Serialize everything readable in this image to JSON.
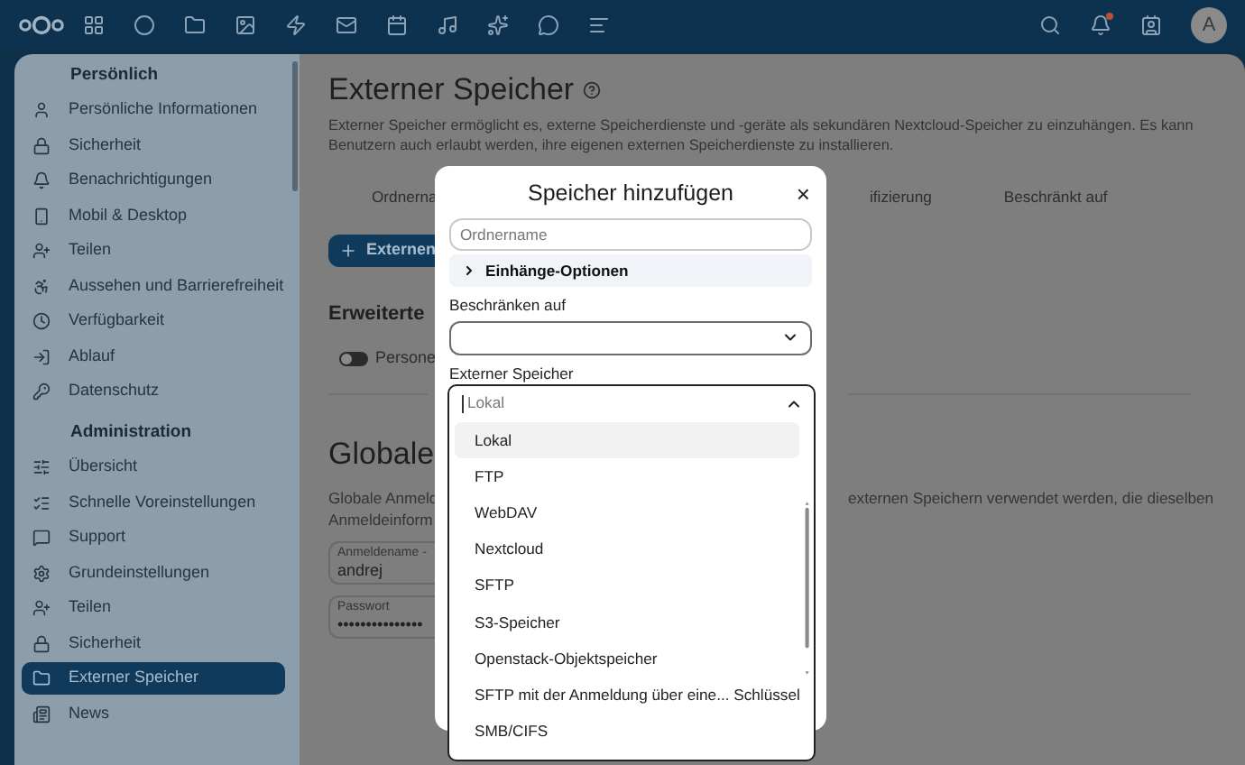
{
  "topbar": {
    "avatar": "A",
    "notification_dot": true
  },
  "sidebar": {
    "sections": [
      {
        "title": "Persönlich",
        "items": [
          {
            "label": "Persönliche Informationen",
            "selected": false
          },
          {
            "label": "Sicherheit",
            "selected": false
          },
          {
            "label": "Benachrichtigungen",
            "selected": false
          },
          {
            "label": "Mobil & Desktop",
            "selected": false
          },
          {
            "label": "Teilen",
            "selected": false
          },
          {
            "label": "Aussehen und Barrierefreiheit",
            "selected": false
          },
          {
            "label": "Verfügbarkeit",
            "selected": false
          },
          {
            "label": "Ablauf",
            "selected": false
          },
          {
            "label": "Datenschutz",
            "selected": false
          }
        ]
      },
      {
        "title": "Administration",
        "items": [
          {
            "label": "Übersicht",
            "selected": false
          },
          {
            "label": "Schnelle Voreinstellungen",
            "selected": false
          },
          {
            "label": "Support",
            "selected": false
          },
          {
            "label": "Grundeinstellungen",
            "selected": false
          },
          {
            "label": "Teilen",
            "selected": false
          },
          {
            "label": "Sicherheit",
            "selected": false
          },
          {
            "label": "Externer Speicher",
            "selected": true
          },
          {
            "label": "News",
            "selected": false
          }
        ]
      }
    ]
  },
  "content": {
    "title": "Externer Speicher",
    "description": "Externer Speicher ermöglicht es, externe Speicherdienste und -geräte als sekundären Nextcloud-Speicher zu einzuhängen. Es kann Benutzern auch erlaubt werden, ihre eigenen externen Speicherdienste zu installieren.",
    "table_columns_left": [
      "Ordnerna"
    ],
    "table_columns_right": [
      "ifizierung",
      "Beschränkt auf"
    ],
    "add_button": "Externen",
    "advanced_heading": "Erweiterte",
    "toggle": {
      "label": "Persone",
      "on": false
    },
    "global_heading": "Globale",
    "global_text_left": [
      "Globale Anmeld",
      "Anmeldeinform"
    ],
    "global_text_right": "externen Speichern verwendet werden, die dieselben",
    "fields": [
      {
        "label": "Anmeldename -",
        "value": "andrej"
      },
      {
        "label": "Passwort",
        "value": "•••••••••••••••"
      }
    ]
  },
  "dialog": {
    "title": "Speicher hinzufügen",
    "close": "×",
    "folder_field": {
      "placeholder": "Ordnername"
    },
    "mount_options": {
      "label": "Einhänge-Optionen",
      "expanded": false
    },
    "restrict_label": "Beschränken auf",
    "storage_label": "Externer Speicher",
    "storage_select": {
      "placeholder": "Lokal",
      "open": true,
      "options": [
        {
          "label": "Lokal",
          "selected": true
        },
        {
          "label": "FTP",
          "selected": false
        },
        {
          "label": "WebDAV",
          "selected": false
        },
        {
          "label": "Nextcloud",
          "selected": false
        },
        {
          "label": "SFTP",
          "selected": false
        },
        {
          "label": "S3-Speicher",
          "selected": false
        },
        {
          "label": "Openstack-Objektspeicher",
          "selected": false
        },
        {
          "label": "SFTP mit der Anmeldung über eine... Schlüssel",
          "selected": false
        },
        {
          "label": "SMB/CIFS",
          "selected": false
        }
      ]
    }
  }
}
